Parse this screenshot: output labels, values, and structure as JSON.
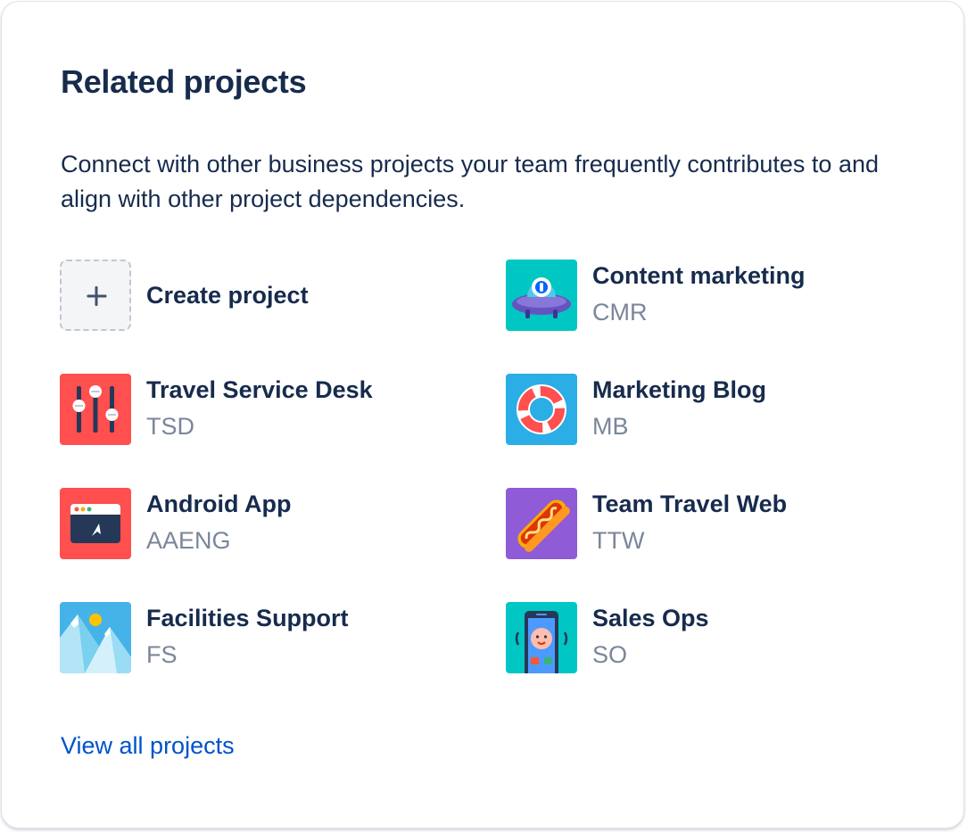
{
  "panel": {
    "title": "Related projects",
    "description": "Connect with other business projects your team frequently contributes to and align with other project dependencies.",
    "view_all_label": "View all projects"
  },
  "create": {
    "label": "Create project",
    "icon": "plus-icon"
  },
  "projects": [
    {
      "name": "Content marketing",
      "key": "CMR",
      "icon": "ufo-icon",
      "color": "#00c7c3"
    },
    {
      "name": "Travel Service Desk",
      "key": "TSD",
      "icon": "sliders-icon",
      "color": "#ff4f4f"
    },
    {
      "name": "Marketing Blog",
      "key": "MB",
      "icon": "lifebuoy-icon",
      "color": "#2baee6"
    },
    {
      "name": "Android App",
      "key": "AAENG",
      "icon": "browser-window-icon",
      "color": "#ff4f4f"
    },
    {
      "name": "Team Travel Web",
      "key": "TTW",
      "icon": "hotdog-icon",
      "color": "#8f5bd6"
    },
    {
      "name": "Facilities Support",
      "key": "FS",
      "icon": "mountains-icon",
      "color": "#45b3e8"
    },
    {
      "name": "Sales Ops",
      "key": "SO",
      "icon": "phone-face-icon",
      "color": "#00c7c3"
    }
  ]
}
